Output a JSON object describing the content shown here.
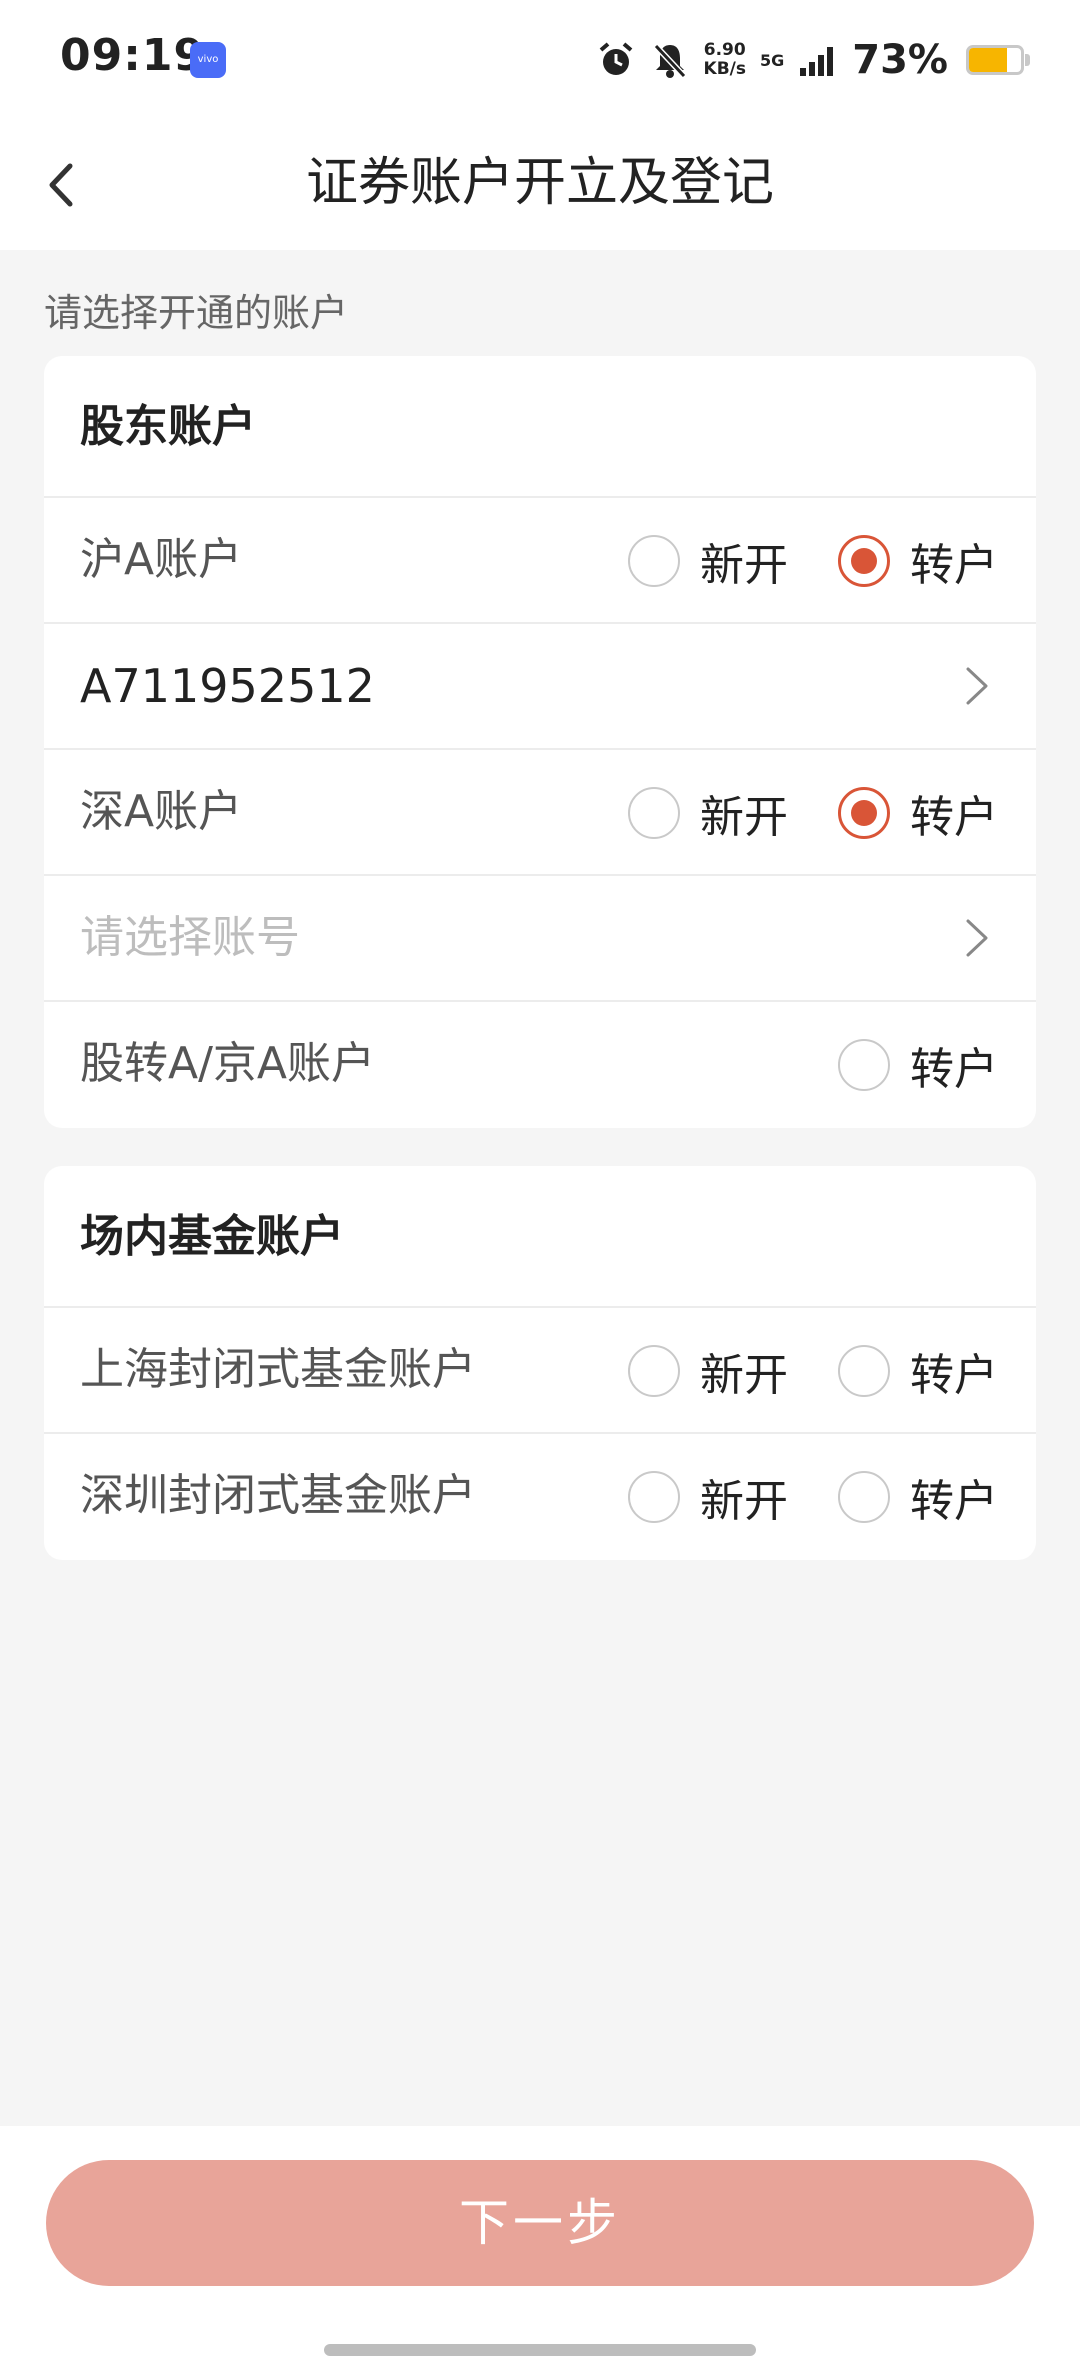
{
  "status_bar": {
    "time": "09:19",
    "brand_badge": "vivo",
    "net_speed_value": "6.90",
    "net_speed_unit": "KB/s",
    "network": "5G",
    "battery_percent": "73%",
    "battery_level": 0.73,
    "icons": [
      "alarm-icon",
      "mute-bell-icon",
      "signal-icon",
      "battery-icon"
    ]
  },
  "nav": {
    "title": "证券账户开立及登记",
    "back_icon": "back-chevron-icon"
  },
  "section_hint": "请选择开通的账户",
  "shareholder_card": {
    "title": "股东账户",
    "sh_a": {
      "label": "沪A账户",
      "new_label": "新开",
      "transfer_label": "转户",
      "selected": "transfer"
    },
    "sh_account_value": "A711952512",
    "sz_a": {
      "label": "深A账户",
      "new_label": "新开",
      "transfer_label": "转户",
      "selected": "transfer"
    },
    "sz_account_placeholder": "请选择账号",
    "neeq": {
      "label": "股转A/京A账户",
      "transfer_label": "转户",
      "selected": null
    }
  },
  "fund_card": {
    "title": "场内基金账户",
    "sh_fund": {
      "label": "上海封闭式基金账户",
      "new_label": "新开",
      "transfer_label": "转户",
      "selected": null
    },
    "sz_fund": {
      "label": "深圳封闭式基金账户",
      "new_label": "新开",
      "transfer_label": "转户",
      "selected": null
    }
  },
  "next_button": "下一步",
  "colors": {
    "accent": "#d95537",
    "button_disabled": "#e8a499",
    "background": "#f5f5f5",
    "battery": "#f7b500"
  }
}
